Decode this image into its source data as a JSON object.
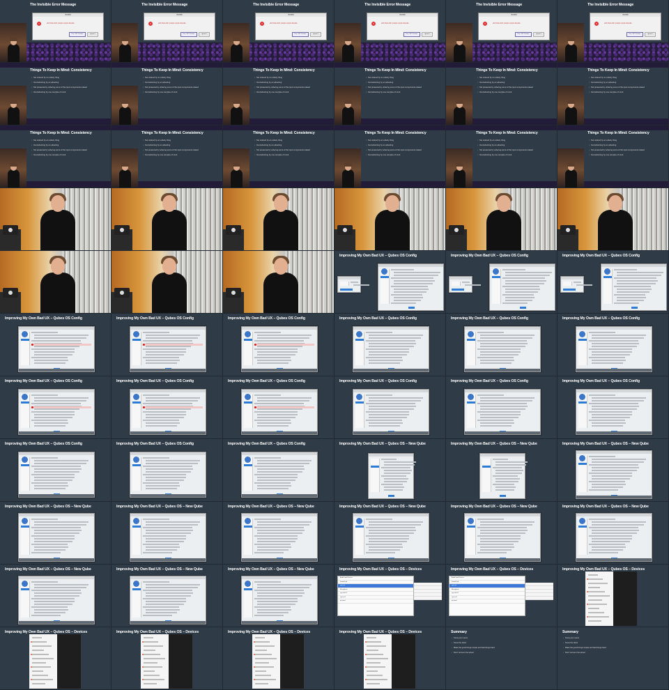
{
  "slides": {
    "error": {
      "title": "The Invisible Error Message",
      "dialog_title": "WORD",
      "message": "duh thek duh merek merek derede",
      "button_primary": "Um, OK? Thanks",
      "button_secondary": "Ignore?"
    },
    "consistency": {
      "title": "Things To Keep In Mind: Consistency",
      "bullets": [
        "Not ordered by an orderly thing",
        "Overwhelming by an attracting",
        "Not presented by ordering some of the input components related",
        "Overwhelming by one complex of mind"
      ]
    },
    "config": {
      "title": "Improving My Own Bad UX – Qubes OS Config"
    },
    "newqube": {
      "title": "Improving My Own Bad UX – Qubes OS – New Qube"
    },
    "devices": {
      "title": "Improving My Own Bad UX – Qubes OS – Devices",
      "rows": [
        "Audio Input Devices",
        "SoundCard",
        "sys-usb",
        "Microphone",
        "sys-usb:2-1",
        "sys-net:1",
        "personal"
      ]
    },
    "summary": {
      "title": "Summary",
      "bullets": [
        "Know your users",
        "Know the tasks",
        "Make the good things simple and bad things hard",
        "Don't reinvent the wheel"
      ]
    }
  },
  "cells": [
    "error",
    "error",
    "error",
    "error",
    "error",
    "error",
    "consistency",
    "consistency",
    "consistency",
    "consistency",
    "consistency",
    "consistency",
    "consistency",
    "consistency",
    "consistency",
    "consistency",
    "consistency",
    "consistency",
    "photo",
    "photo",
    "photo",
    "photo",
    "photo",
    "photo",
    "photo",
    "photo",
    "photo",
    "config_two",
    "config_two",
    "config_two",
    "config",
    "config",
    "config",
    "config",
    "config",
    "config",
    "config",
    "config",
    "config",
    "config",
    "config",
    "config",
    "config",
    "config",
    "config",
    "newqube_small",
    "newqube_small",
    "newqube",
    "newqube",
    "newqube",
    "newqube",
    "newqube",
    "newqube",
    "newqube",
    "newqube",
    "newqube",
    "newqube",
    "devices",
    "devices",
    "devices_dark",
    "devices_dark",
    "devices_dark",
    "devices_dark",
    "devices_dark",
    "summary",
    "summary"
  ]
}
